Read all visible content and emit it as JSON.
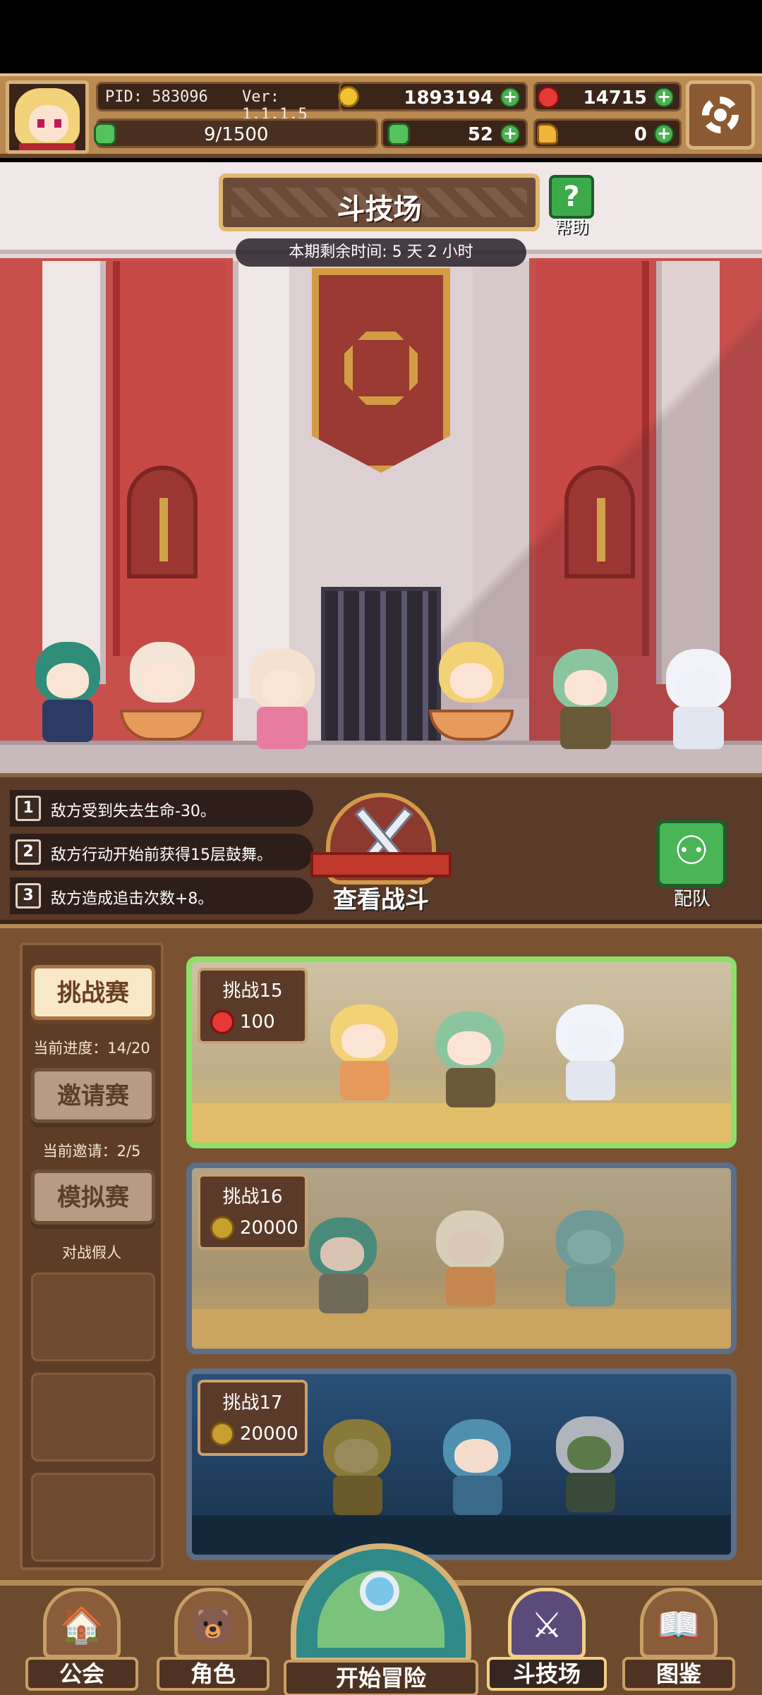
{
  "header": {
    "pid": "PID: 583096",
    "version": "Ver: 1.1.1.5",
    "gold": "1893194",
    "gems": "14715",
    "energy": "9/1500",
    "energy_fraction": 0.006,
    "clover": "52",
    "hand": "0"
  },
  "scene": {
    "title": "斗技场",
    "help_label": "帮助",
    "timer": "本期剩余时间: 5 天 2 小时"
  },
  "rules": [
    {
      "num": "1",
      "text": "敌方受到失去生命-30。"
    },
    {
      "num": "2",
      "text": "敌方行动开始前获得15层鼓舞。"
    },
    {
      "num": "3",
      "text": "敌方造成追击次数+8。"
    }
  ],
  "actions": {
    "view_battle": "查看战斗",
    "team": "配队"
  },
  "side": {
    "challenge": "挑战赛",
    "challenge_progress": "当前进度：14/20",
    "invite": "邀请赛",
    "invite_progress": "当前邀请：2/5",
    "simulate": "模拟赛",
    "simulate_sub": "对战假人"
  },
  "cards": [
    {
      "title": "挑战15",
      "cost": "100",
      "currency": "gem-icon"
    },
    {
      "title": "挑战16",
      "cost": "20000",
      "currency": "coin-icon"
    },
    {
      "title": "挑战17",
      "cost": "20000",
      "currency": "coin-icon"
    }
  ],
  "nav": {
    "guild": "公会",
    "character": "角色",
    "adventure": "开始冒险",
    "arena": "斗技场",
    "codex": "图鉴"
  },
  "colors": {
    "gold": "#f1c232",
    "gem": "#e53935",
    "green": "#4caf50",
    "frame": "#b98a52"
  }
}
